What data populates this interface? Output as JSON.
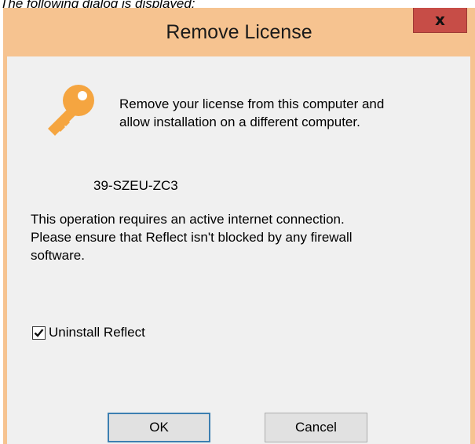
{
  "caption": "The following dialog is displayed:",
  "dialog": {
    "title": "Remove License",
    "close_label": "x",
    "icon": "key-icon",
    "intro_lines": [
      "Remove your license from this computer and",
      "allow installation on a different computer."
    ],
    "license_code": "39-SZEU-ZC3",
    "info_lines": [
      "This operation requires an active internet connection.",
      "Please ensure that Reflect isn't blocked by any firewall",
      "software."
    ],
    "uninstall_checkbox": {
      "label": "Uninstall Reflect",
      "checked": true
    },
    "ok_label": "OK",
    "cancel_label": "Cancel"
  },
  "colors": {
    "window_frame": "#f6c390",
    "close_button": "#c74d47",
    "client_background": "#f0f0f0",
    "key_icon": "#f5a540",
    "default_button_border": "#3c7fb1"
  }
}
